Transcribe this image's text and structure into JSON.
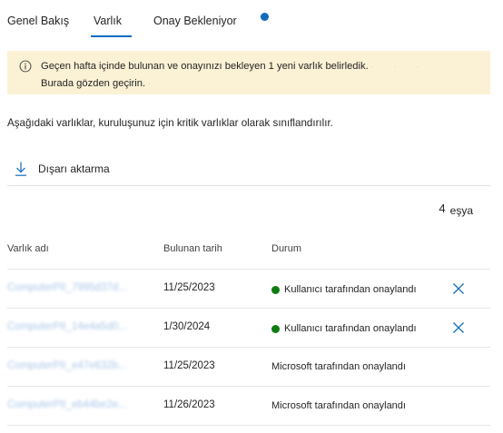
{
  "tabs": [
    {
      "label": "Genel Bakış"
    },
    {
      "label": "Varlık"
    },
    {
      "label": "Onay Bekleniyor"
    }
  ],
  "active_tab": "Varlık",
  "banner": {
    "icon": "info-icon",
    "line1": "Geçen hafta içinde bulunan ve onayınızı bekleyen 1 yeni varlık belirledik.",
    "line2": "Burada gözden geçirin."
  },
  "intro": "Aşağıdaki varlıklar, kuruluşunuz için kritik varlıklar olarak sınıflandırılır.",
  "toolbar": {
    "export_label": "Dışarı aktarma",
    "export_icon": "download-icon"
  },
  "count": {
    "number": "4",
    "unit": "eşya"
  },
  "table": {
    "columns": [
      "Varlık adı",
      "Bulunan tarih",
      "Durum"
    ],
    "rows": [
      {
        "name": "ComputerPII_7995d37d...",
        "date": "11/25/2023",
        "status": "Kullanıcı tarafından onaylandı",
        "status_dot": true,
        "action": "close-icon"
      },
      {
        "name": "ComputerPII_14e4a5d0...",
        "date": "1/30/2024",
        "status": "Kullanıcı tarafından onaylandı",
        "status_dot": true,
        "action": "close-icon"
      },
      {
        "name": "ComputerPII_e47e632b...",
        "date": "11/25/2023",
        "status": "Microsoft tarafından onaylandı",
        "status_dot": false,
        "action": null
      },
      {
        "name": "ComputerPII_eb44be2e...",
        "date": "11/26/2023",
        "status": "Microsoft tarafından onaylandı",
        "status_dot": false,
        "action": null
      }
    ]
  },
  "colors": {
    "accent": "#0f6cbd",
    "banner_bg": "#fbf1d5",
    "status_green": "#107c10",
    "link_blurred": "#a8c6e8"
  }
}
